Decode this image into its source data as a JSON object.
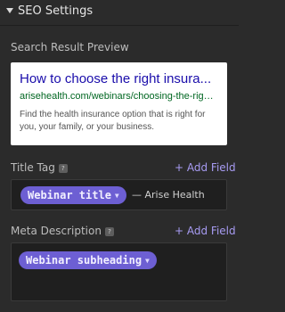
{
  "panel": {
    "title": "SEO Settings"
  },
  "preview": {
    "section_label": "Search Result Preview",
    "title": "How to choose the right insura...",
    "url": "arisehealth.com/webinars/choosing-the-right-p...",
    "description": "Find the health insurance option that is right for you, your family, or your business."
  },
  "title_tag": {
    "label": "Title Tag",
    "help": "?",
    "add_field": "+ Add Field",
    "token": "Webinar title",
    "suffix": "— Arise Health"
  },
  "meta_description": {
    "label": "Meta Description",
    "help": "?",
    "add_field": "+ Add Field",
    "token": "Webinar subheading"
  },
  "icons": {
    "collapse": "chevron-down-icon",
    "help": "help-icon",
    "token_caret": "chevron-down-icon"
  },
  "colors": {
    "accent": "#a79bf2",
    "token_bg": "#6d5fd3",
    "preview_title": "#1a0dab",
    "preview_url": "#006621"
  }
}
